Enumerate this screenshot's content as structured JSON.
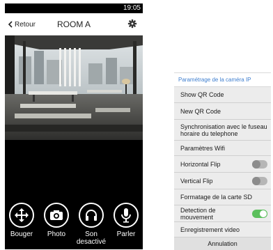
{
  "status_bar": {
    "time": "19:05"
  },
  "header": {
    "back_label": "Retour",
    "title": "ROOM A"
  },
  "controls": [
    {
      "label": "Bouger",
      "icon": "move-arrows-icon"
    },
    {
      "label": "Photo",
      "icon": "camera-icon"
    },
    {
      "label": "Son\ndesactivé",
      "icon": "headphones-icon"
    },
    {
      "label": "Parler",
      "icon": "microphone-icon"
    }
  ],
  "settings_menu": {
    "title": "Paramétrage de la caméra IP",
    "items": [
      {
        "label": "Show QR Code"
      },
      {
        "label": "New QR Code"
      },
      {
        "label": "Synchronisation avec le fuseau horaire du telephone"
      },
      {
        "label": "Paramètres Wifi"
      },
      {
        "label": "Horizontal Flip",
        "toggle": false
      },
      {
        "label": "Vertical Flip",
        "toggle": false
      },
      {
        "label": "Formatage de la carte SD"
      },
      {
        "label": "Detection de mouvement",
        "toggle": true
      },
      {
        "label": "Enregistrement video"
      }
    ],
    "cancel_label": "Annulation"
  },
  "colors": {
    "accent": "#3f7fcf",
    "toggle_on": "#5bbf5c"
  }
}
